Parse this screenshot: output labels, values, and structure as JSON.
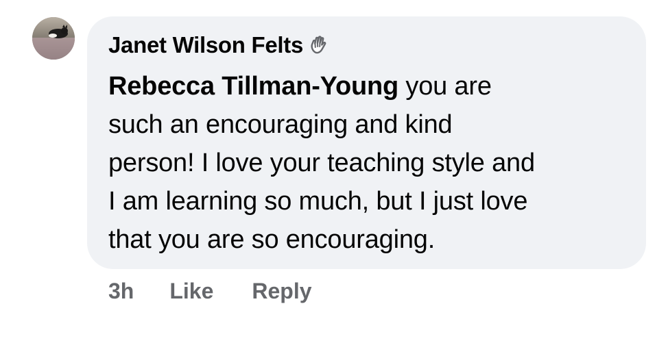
{
  "comment": {
    "author": "Janet Wilson Felts",
    "badge_icon": "waving-hand-icon",
    "mention": "Rebecca Tillman-Young",
    "text_lines": [
      " you are",
      "such an encouraging and kind",
      "person! I love your teaching style and",
      "I am learning so much, but I just love",
      "that you are so encouraging."
    ],
    "timestamp": "3h",
    "like_label": "Like",
    "reply_label": "Reply"
  },
  "colors": {
    "bubble": "#f0f2f5",
    "text": "#050505",
    "secondary_text": "#65676b"
  }
}
